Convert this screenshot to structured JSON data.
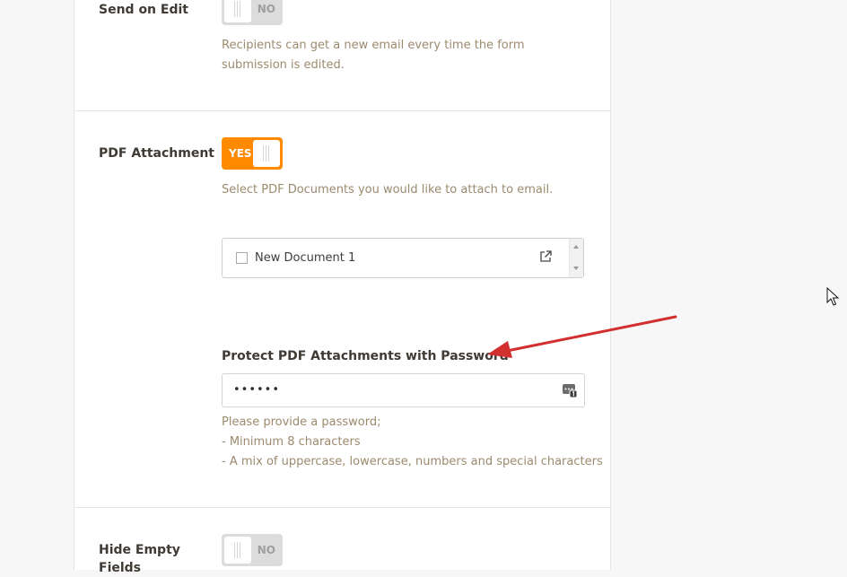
{
  "send_on_edit": {
    "label": "Send on Edit",
    "toggle_text": "NO",
    "toggle_state": "off",
    "description": "Recipients can get a new email every time the form submission is edited."
  },
  "pdf_attachment": {
    "label": "PDF Attachment",
    "toggle_text": "YES",
    "toggle_state": "on",
    "description": "Select PDF Documents you would like to attach to email.",
    "documents": [
      {
        "label": "New Document 1",
        "checked": false
      }
    ]
  },
  "password": {
    "heading": "Protect PDF Attachments with Password",
    "value": "••••••",
    "hints": [
      "Please provide a password;",
      "- Minimum 8 characters",
      "- A mix of uppercase, lowercase, numbers and special characters"
    ]
  },
  "hide_empty_fields": {
    "label_line1": "Hide Empty",
    "label_line2": "Fields",
    "toggle_text": "NO",
    "toggle_state": "off"
  },
  "colors": {
    "accent_orange": "#ff8a00",
    "annotation_red": "#d22f2f",
    "description_text": "#9c8a6e"
  }
}
